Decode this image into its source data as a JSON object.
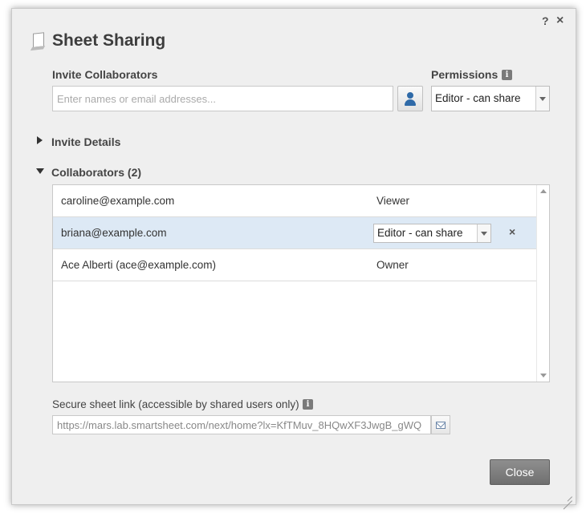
{
  "dialog": {
    "title": "Sheet Sharing",
    "help_label": "?",
    "close_label": "×"
  },
  "invite": {
    "label": "Invite Collaborators",
    "placeholder": "Enter names or email addresses...",
    "value": ""
  },
  "permissions": {
    "label": "Permissions",
    "info_icon": "i",
    "selected": "Editor - can share"
  },
  "invite_details": {
    "label": "Invite Details",
    "expanded": false
  },
  "collaborators": {
    "label": "Collaborators (2)",
    "expanded": true,
    "rows": [
      {
        "email": "caroline@example.com",
        "permission": "Viewer",
        "selected": false
      },
      {
        "email": "briana@example.com",
        "permission": "Editor - can share",
        "selected": true,
        "remove_label": "×"
      },
      {
        "email": "Ace Alberti (ace@example.com)",
        "permission": "Owner",
        "selected": false
      }
    ]
  },
  "secure_link": {
    "label": "Secure sheet link (accessible by shared users only)",
    "info_icon": "i",
    "url": "https://mars.lab.smartsheet.com/next/home?lx=KfTMuv_8HQwXF3JwgB_gWQ"
  },
  "footer": {
    "close_button": "Close"
  },
  "colors": {
    "accent_blue": "#2f6aa8",
    "selected_row": "#dde9f5",
    "close_button": "#7f7f7f"
  }
}
